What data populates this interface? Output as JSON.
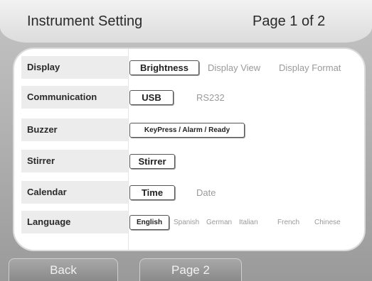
{
  "header": {
    "title": "Instrument Setting",
    "page_indicator": "Page 1 of 2"
  },
  "rows": [
    {
      "label": "Display",
      "options": [
        {
          "label": "Brightness",
          "selected": true
        },
        {
          "label": "Display View",
          "selected": false
        },
        {
          "label": "Display Format",
          "selected": false
        }
      ]
    },
    {
      "label": "Communication",
      "options": [
        {
          "label": "USB",
          "selected": true
        },
        {
          "label": "RS232",
          "selected": false
        }
      ]
    },
    {
      "label": "Buzzer",
      "options": [
        {
          "label": "KeyPress / Alarm / Ready",
          "selected": true
        }
      ]
    },
    {
      "label": "Stirrer",
      "options": [
        {
          "label": "Stirrer",
          "selected": true
        }
      ]
    },
    {
      "label": "Calendar",
      "options": [
        {
          "label": "Time",
          "selected": true
        },
        {
          "label": "Date",
          "selected": false
        }
      ]
    },
    {
      "label": "Language",
      "options": [
        {
          "label": "English",
          "selected": true
        },
        {
          "label": "Spanish",
          "selected": false
        },
        {
          "label": "German",
          "selected": false
        },
        {
          "label": "Italian",
          "selected": false
        },
        {
          "label": "French",
          "selected": false
        },
        {
          "label": "Chinese",
          "selected": false
        }
      ]
    }
  ],
  "footer": {
    "back_label": "Back",
    "page2_label": "Page 2"
  }
}
